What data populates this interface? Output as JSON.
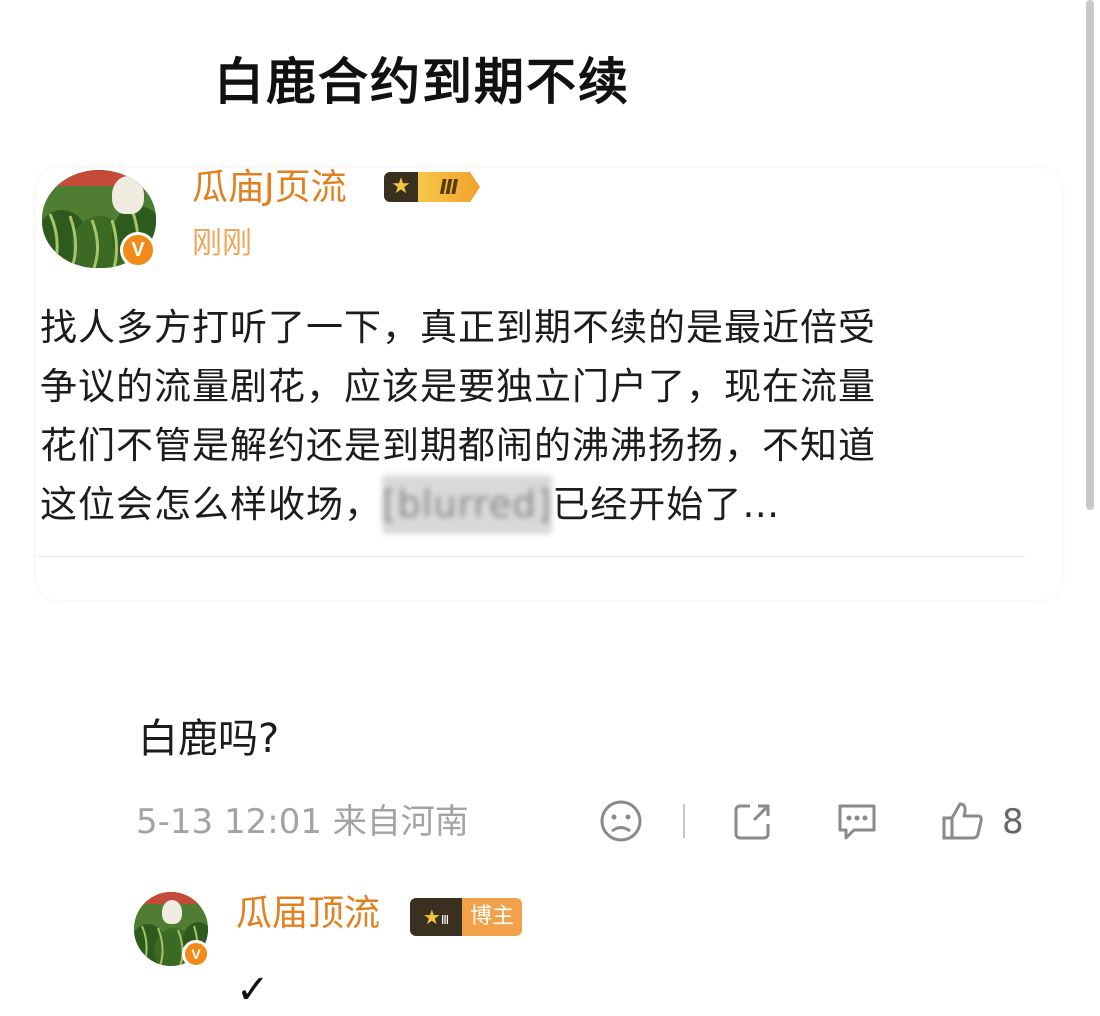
{
  "headline": "白鹿合约到期不续",
  "post": {
    "author": "瓜庙J页流",
    "rank_level": "Ⅲ",
    "time": "刚刚",
    "body_lines": [
      "找人多方打听了一下，真正到期不续的是最近倍受",
      "争议的流量剧花，应该是要独立门户了，现在流量",
      "花们不管是解约还是到期都闹的沸沸扬扬，不知道"
    ],
    "body_last_visible_start": "这位会怎么样收场，",
    "body_last_blurred": "[blurred]",
    "body_last_visible_end": "已经开始了…"
  },
  "reply": {
    "text": "白鹿吗?",
    "meta": "5-13 12:01 来自河南",
    "likes": "8",
    "author": "瓜届顶流",
    "rank_level": "Ⅲ",
    "blogger_tag": "博主",
    "answer": "✓"
  },
  "icons": {
    "verified": "V",
    "crown": "★",
    "sad_face": "sad-face-icon",
    "share": "share-icon",
    "comment": "comment-icon",
    "like": "thumbs-up-icon"
  },
  "colors": {
    "author": "#e2801f",
    "time": "#f0a55a",
    "badge": "#f28a1a"
  }
}
